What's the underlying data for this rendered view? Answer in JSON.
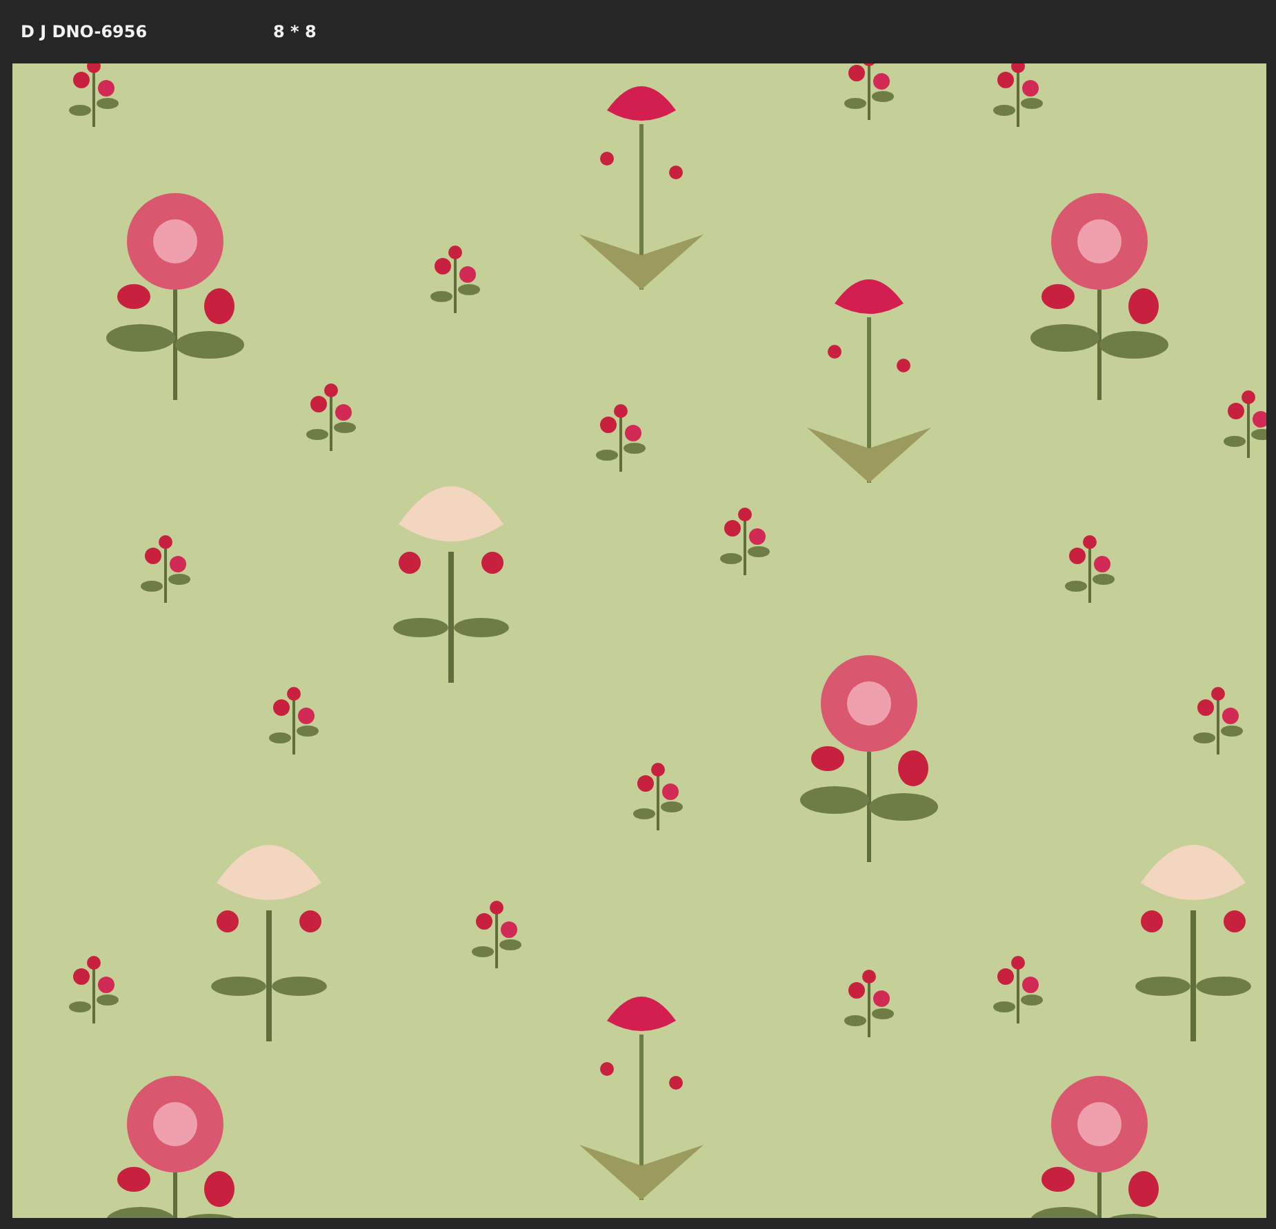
{
  "document": {
    "title": "D J DNO-6956",
    "size": "8 * 8"
  }
}
